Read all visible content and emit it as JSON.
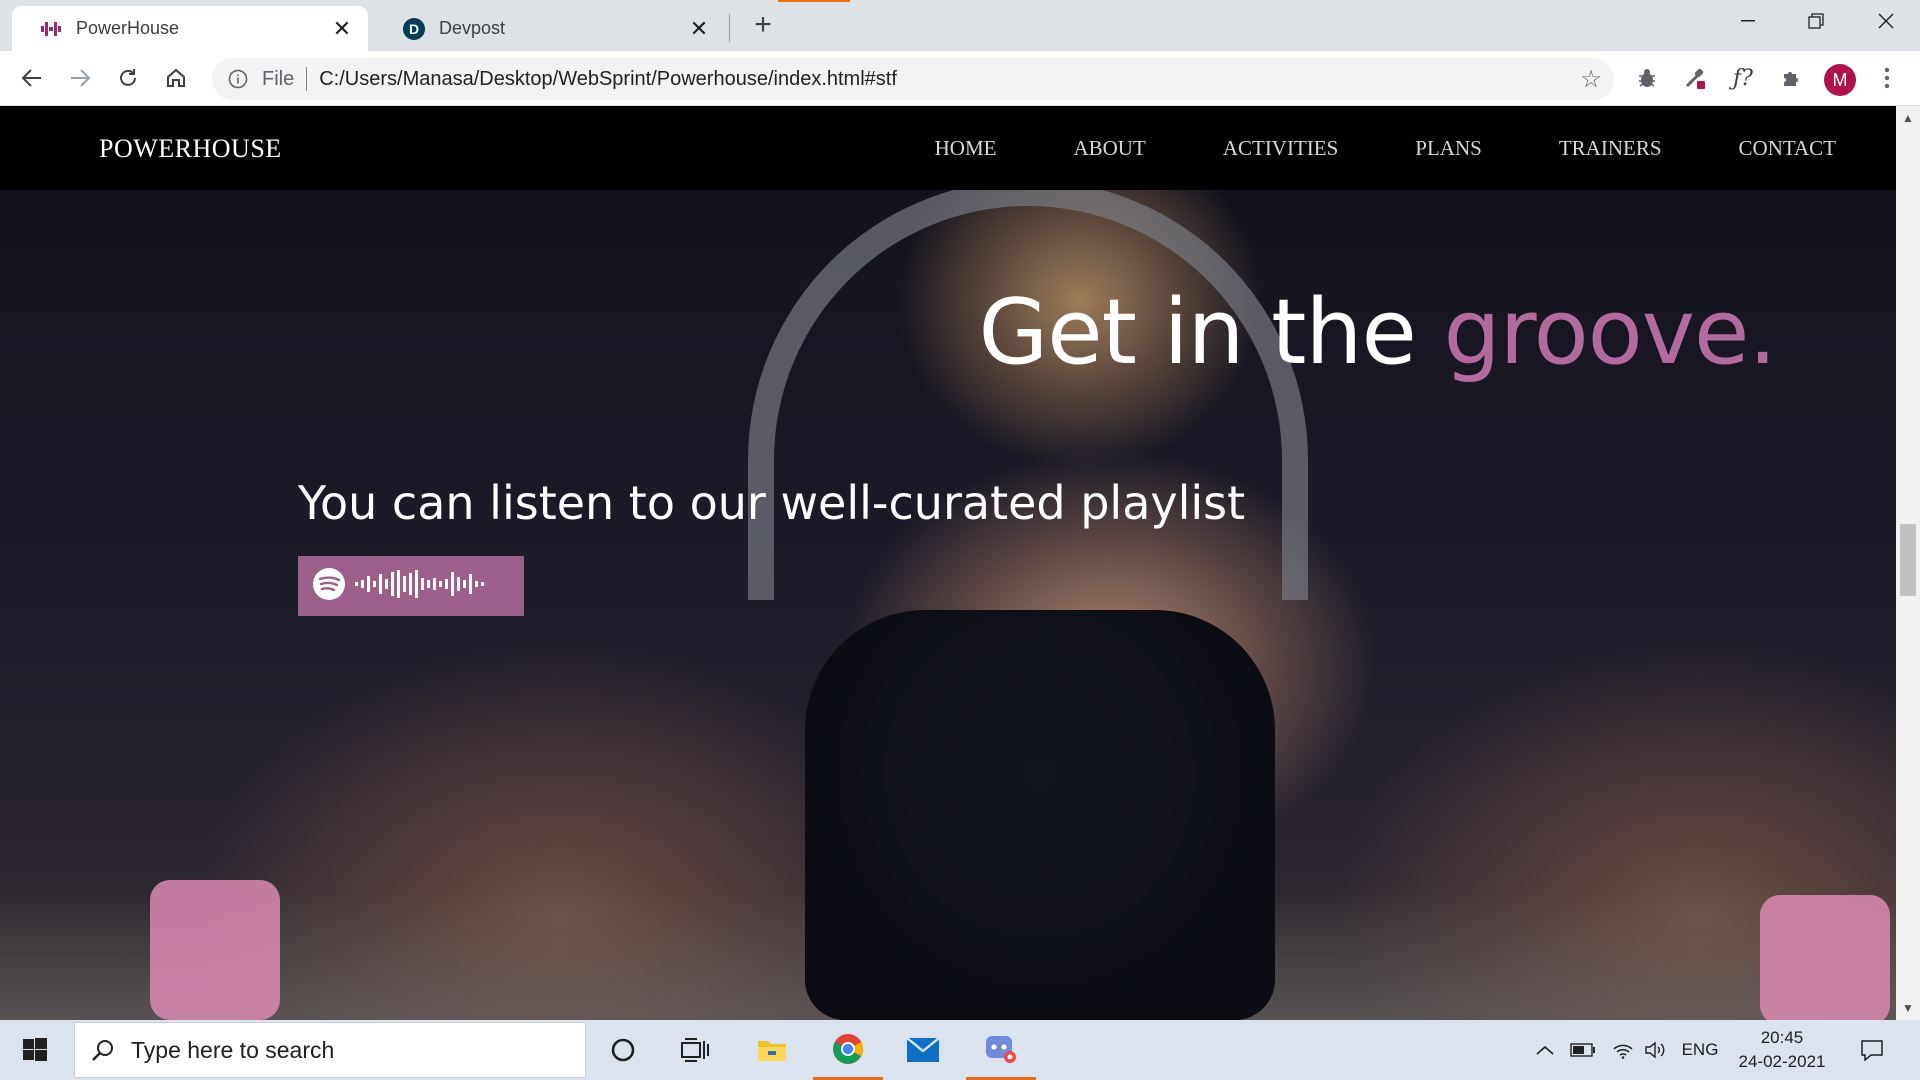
{
  "browser": {
    "tabs": [
      {
        "title": "PowerHouse",
        "favicon": "dumbbell-icon",
        "active": true
      },
      {
        "title": "Devpost",
        "favicon": "devpost-d-icon",
        "active": false
      }
    ],
    "address": {
      "info_label": "File",
      "url": "C:/Users/Manasa/Desktop/WebSprint/Powerhouse/index.html#stf"
    },
    "profile_initial": "M",
    "colors": {
      "profile": "#b0124e",
      "loading": "#e8710a"
    }
  },
  "site": {
    "brand": "POWERHOUSE",
    "nav": [
      "HOME",
      "ABOUT",
      "ACTIVITIES",
      "PLANS",
      "TRAINERS",
      "CONTACT"
    ],
    "hero": {
      "headline_main": "Get in the ",
      "headline_accent": "groove.",
      "subheadline": "You can listen to our well-curated playlist",
      "spotify_code": "spotify-code-icon"
    },
    "colors": {
      "accent": "#b26b9c",
      "nav_bg": "#000000",
      "spotify_bg": "#9c5f8a"
    }
  },
  "taskbar": {
    "search_placeholder": "Type here to search",
    "language": "ENG",
    "time": "20:45",
    "date": "24-02-2021"
  }
}
